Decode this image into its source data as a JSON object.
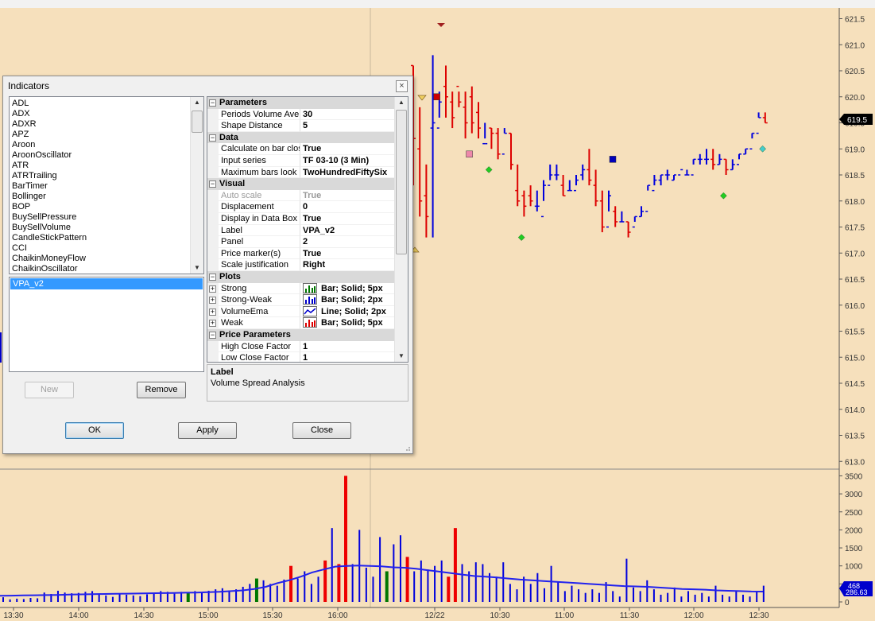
{
  "dialog": {
    "title": "Indicators",
    "indicators": [
      "ADL",
      "ADX",
      "ADXR",
      "APZ",
      "Aroon",
      "AroonOscillator",
      "ATR",
      "ATRTrailing",
      "BarTimer",
      "Bollinger",
      "BOP",
      "BuySellPressure",
      "BuySellVolume",
      "CandleStickPattern",
      "CCI",
      "ChaikinMoneyFlow",
      "ChaikinOscillator"
    ],
    "active_indicator": "VPA_v2",
    "buttons": {
      "new": "New",
      "remove": "Remove",
      "ok": "OK",
      "apply": "Apply",
      "close": "Close"
    },
    "properties": [
      {
        "type": "category",
        "label": "Parameters"
      },
      {
        "name": "Periods Volume Average",
        "value": "30"
      },
      {
        "name": "Shape Distance",
        "value": "5"
      },
      {
        "type": "category",
        "label": "Data"
      },
      {
        "name": "Calculate on bar close",
        "value": "True"
      },
      {
        "name": "Input series",
        "value": "TF 03-10 (3 Min)"
      },
      {
        "name": "Maximum bars look back",
        "value": "TwoHundredFiftySix"
      },
      {
        "type": "category",
        "label": "Visual"
      },
      {
        "name": "Auto scale",
        "value": "True",
        "disabled": true
      },
      {
        "name": "Displacement",
        "value": "0"
      },
      {
        "name": "Display in Data Box",
        "value": "True"
      },
      {
        "name": "Label",
        "value": "VPA_v2"
      },
      {
        "name": "Panel",
        "value": "2"
      },
      {
        "name": "Price marker(s)",
        "value": "True"
      },
      {
        "name": "Scale justification",
        "value": "Right"
      },
      {
        "type": "category",
        "label": "Plots"
      },
      {
        "name": "Strong",
        "value": "Bar; Solid; 5px",
        "icon": "bar-green",
        "expandable": true
      },
      {
        "name": "Strong-Weak",
        "value": "Bar; Solid; 2px",
        "icon": "bar-blue",
        "expandable": true
      },
      {
        "name": "VolumeEma",
        "value": "Line; Solid; 2px",
        "icon": "line-blue",
        "expandable": true
      },
      {
        "name": "Weak",
        "value": "Bar; Solid; 5px",
        "icon": "bar-red",
        "expandable": true
      },
      {
        "type": "category",
        "label": "Price Parameters"
      },
      {
        "name": "High Close Factor",
        "value": "1"
      },
      {
        "name": "Low Close Factor",
        "value": "1"
      }
    ],
    "description": {
      "title": "Label",
      "text": "Volume Spread Analysis"
    }
  },
  "price_axis": {
    "labels": [
      "621.5",
      "621.0",
      "620.5",
      "620.0",
      "619.5",
      "619.0",
      "618.5",
      "618.0",
      "617.5",
      "617.0",
      "616.5",
      "616.0",
      "615.5",
      "615.0",
      "614.5",
      "614.0",
      "613.5",
      "613.0"
    ],
    "current_price": "619.5",
    "current_price_color": "#000000"
  },
  "volume_axis": {
    "labels": [
      "3500",
      "3000",
      "2500",
      "2000",
      "1500",
      "1000",
      "500",
      "0"
    ],
    "current_volume": "468",
    "current_ema": "286.63",
    "current_color": "#0000cc"
  },
  "time_axis": {
    "labels": [
      "13:30",
      "14:00",
      "14:30",
      "15:00",
      "15:30",
      "16:00",
      "12/22",
      "10:30",
      "11:00",
      "11:30",
      "12:00",
      "12:30"
    ]
  },
  "colors": {
    "background": "#f6e0bc",
    "up_bar": "#0000dd",
    "down_bar": "#dd0000",
    "strong_volume": "#007700",
    "weak_volume": "#ee0000",
    "ema": "#2222ee"
  },
  "chart_data": {
    "type": "ohlc",
    "price_bars": [
      [
        620.6,
        620.6,
        618.3,
        619.2
      ],
      [
        619.8,
        619.0,
        617.7,
        618.0
      ],
      [
        618.7,
        618.1,
        617.3,
        617.7
      ],
      [
        620.8,
        619.4,
        617.3,
        619.5
      ],
      [
        620.1,
        619.4,
        619.6,
        619.9
      ],
      [
        620.6,
        620.2,
        619.6,
        620.0
      ],
      [
        620.1,
        619.9,
        619.4,
        619.6
      ],
      [
        620.1,
        620.2,
        619.8,
        619.9
      ],
      [
        620.1,
        619.8,
        619.2,
        619.5
      ],
      [
        620.2,
        620.0,
        619.3,
        619.5
      ],
      [
        619.9,
        619.7,
        619.2,
        619.4
      ],
      [
        619.5,
        619.1,
        619.2,
        619.1
      ],
      [
        619.4,
        619.4,
        619.0,
        619.3
      ],
      [
        619.4,
        619.3,
        618.8,
        618.9
      ],
      [
        619.4,
        618.9,
        619.3,
        619.3
      ],
      [
        619.3,
        619.3,
        618.6,
        618.7
      ],
      [
        618.7,
        618.2,
        617.9,
        618.0
      ],
      [
        618.2,
        618.1,
        617.7,
        617.9
      ],
      [
        618.3,
        618.1,
        617.9,
        618.0
      ],
      [
        618.2,
        617.9,
        617.8,
        617.9
      ],
      [
        618.4,
        617.7,
        618.0,
        618.3
      ],
      [
        618.7,
        618.3,
        618.4,
        618.5
      ],
      [
        618.7,
        618.5,
        618.4,
        618.5
      ],
      [
        618.5,
        618.3,
        618.1,
        618.1
      ],
      [
        618.4,
        618.2,
        618.2,
        618.2
      ],
      [
        618.5,
        618.2,
        618.3,
        618.4
      ],
      [
        618.7,
        618.5,
        618.4,
        618.6
      ],
      [
        619.0,
        618.6,
        618.3,
        618.4
      ],
      [
        618.6,
        618.3,
        617.9,
        618.0
      ],
      [
        618.2,
        618.0,
        617.4,
        617.5
      ],
      [
        618.2,
        617.5,
        617.8,
        618.1
      ],
      [
        617.9,
        617.8,
        617.5,
        617.6
      ],
      [
        617.8,
        617.6,
        617.6,
        617.6
      ],
      [
        617.6,
        617.6,
        617.3,
        617.4
      ],
      [
        617.7,
        617.5,
        617.6,
        617.7
      ],
      [
        617.9,
        617.7,
        617.7,
        617.8
      ],
      [
        618.3,
        617.8,
        618.2,
        618.3
      ],
      [
        618.5,
        618.2,
        618.3,
        618.4
      ],
      [
        618.5,
        618.4,
        618.3,
        618.5
      ],
      [
        618.6,
        618.5,
        618.4,
        618.5
      ],
      [
        618.5,
        618.4,
        618.4,
        618.5
      ],
      [
        618.6,
        618.5,
        618.6,
        618.6
      ],
      [
        618.6,
        618.5,
        618.5,
        618.5
      ],
      [
        618.8,
        618.5,
        618.7,
        618.8
      ],
      [
        618.9,
        618.8,
        618.7,
        618.8
      ],
      [
        619.0,
        618.8,
        618.7,
        618.8
      ],
      [
        619.0,
        618.8,
        618.6,
        618.7
      ],
      [
        618.9,
        618.7,
        618.7,
        618.8
      ],
      [
        618.8,
        618.8,
        618.5,
        618.6
      ],
      [
        618.8,
        618.6,
        618.6,
        618.7
      ],
      [
        618.9,
        618.7,
        618.8,
        618.9
      ],
      [
        619.0,
        618.9,
        618.9,
        619.0
      ],
      [
        619.3,
        619.0,
        619.2,
        619.3
      ],
      [
        619.7,
        619.3,
        619.6,
        619.6
      ],
      [
        619.7,
        619.6,
        619.5,
        619.5
      ]
    ],
    "markers": [
      {
        "shape": "square",
        "color": "#cc0000",
        "x": 3,
        "price": 620.0
      },
      {
        "shape": "square",
        "color": "#ee88aa",
        "x": 8,
        "price": 618.9
      },
      {
        "shape": "diamond",
        "color": "#22cc22",
        "x": 11,
        "price": 618.6
      },
      {
        "shape": "diamond",
        "color": "#22cc22",
        "x": 16,
        "price": 617.3
      },
      {
        "shape": "square",
        "color": "#0000bb",
        "x": 30,
        "price": 618.8
      },
      {
        "shape": "diamond",
        "color": "#22cc22",
        "x": 47,
        "price": 618.1
      },
      {
        "shape": "diamond",
        "color": "#44cccc",
        "x": 53,
        "price": 619.0
      }
    ],
    "volume": [
      [
        130,
        "b"
      ],
      [
        70,
        "b"
      ],
      [
        90,
        "b"
      ],
      [
        80,
        "b"
      ],
      [
        110,
        "b"
      ],
      [
        100,
        "b"
      ],
      [
        260,
        "b"
      ],
      [
        220,
        "b"
      ],
      [
        310,
        "b"
      ],
      [
        260,
        "b"
      ],
      [
        240,
        "b"
      ],
      [
        250,
        "b"
      ],
      [
        280,
        "b"
      ],
      [
        300,
        "b"
      ],
      [
        200,
        "b"
      ],
      [
        180,
        "b"
      ],
      [
        140,
        "b"
      ],
      [
        220,
        "b"
      ],
      [
        200,
        "b"
      ],
      [
        180,
        "b"
      ],
      [
        160,
        "b"
      ],
      [
        210,
        "b"
      ],
      [
        240,
        "b"
      ],
      [
        300,
        "b"
      ],
      [
        280,
        "b"
      ],
      [
        230,
        "b"
      ],
      [
        280,
        "b"
      ],
      [
        250,
        "g"
      ],
      [
        300,
        "b"
      ],
      [
        260,
        "b"
      ],
      [
        310,
        "b"
      ],
      [
        350,
        "b"
      ],
      [
        380,
        "b"
      ],
      [
        320,
        "b"
      ],
      [
        350,
        "b"
      ],
      [
        420,
        "b"
      ],
      [
        500,
        "b"
      ],
      [
        650,
        "g"
      ],
      [
        600,
        "b"
      ],
      [
        500,
        "b"
      ],
      [
        450,
        "b"
      ],
      [
        620,
        "b"
      ],
      [
        1000,
        "r"
      ],
      [
        650,
        "b"
      ],
      [
        850,
        "b"
      ],
      [
        500,
        "b"
      ],
      [
        700,
        "b"
      ],
      [
        1150,
        "r"
      ],
      [
        2050,
        "b"
      ],
      [
        1050,
        "r"
      ],
      [
        3500,
        "r"
      ],
      [
        1050,
        "b"
      ],
      [
        2000,
        "b"
      ],
      [
        950,
        "b"
      ],
      [
        700,
        "b"
      ],
      [
        1800,
        "b"
      ],
      [
        850,
        "g"
      ],
      [
        1600,
        "b"
      ],
      [
        1850,
        "b"
      ],
      [
        1250,
        "r"
      ],
      [
        850,
        "b"
      ],
      [
        1150,
        "b"
      ],
      [
        900,
        "b"
      ],
      [
        1000,
        "b"
      ],
      [
        1150,
        "b"
      ],
      [
        700,
        "r"
      ],
      [
        2050,
        "r"
      ],
      [
        1050,
        "b"
      ],
      [
        850,
        "b"
      ],
      [
        1100,
        "b"
      ],
      [
        1050,
        "b"
      ],
      [
        800,
        "b"
      ],
      [
        700,
        "b"
      ],
      [
        1100,
        "b"
      ],
      [
        500,
        "b"
      ],
      [
        350,
        "b"
      ],
      [
        700,
        "b"
      ],
      [
        500,
        "b"
      ],
      [
        800,
        "b"
      ],
      [
        380,
        "b"
      ],
      [
        1000,
        "b"
      ],
      [
        550,
        "b"
      ],
      [
        300,
        "b"
      ],
      [
        450,
        "b"
      ],
      [
        350,
        "b"
      ],
      [
        250,
        "b"
      ],
      [
        350,
        "b"
      ],
      [
        250,
        "b"
      ],
      [
        550,
        "b"
      ],
      [
        300,
        "b"
      ],
      [
        150,
        "b"
      ],
      [
        1200,
        "b"
      ],
      [
        400,
        "b"
      ],
      [
        300,
        "b"
      ],
      [
        600,
        "b"
      ],
      [
        350,
        "b"
      ],
      [
        200,
        "b"
      ],
      [
        250,
        "b"
      ],
      [
        400,
        "b"
      ],
      [
        150,
        "b"
      ],
      [
        300,
        "b"
      ],
      [
        200,
        "b"
      ],
      [
        250,
        "b"
      ],
      [
        150,
        "b"
      ],
      [
        450,
        "b"
      ],
      [
        200,
        "b"
      ],
      [
        150,
        "b"
      ],
      [
        300,
        "b"
      ],
      [
        200,
        "b"
      ],
      [
        150,
        "b"
      ],
      [
        300,
        "b"
      ],
      [
        450,
        "b"
      ]
    ],
    "ema": [
      170,
      175,
      180,
      185,
      190,
      195,
      205,
      210,
      215,
      220,
      225,
      230,
      235,
      240,
      245,
      250,
      255,
      260,
      270,
      280,
      300,
      320,
      360,
      420,
      520,
      600,
      700,
      820,
      900,
      980,
      1000,
      1010,
      1000,
      990,
      960,
      950,
      920,
      880,
      840,
      800,
      760,
      720,
      700,
      680,
      650,
      620,
      600,
      580,
      560,
      540,
      520,
      500,
      480,
      460,
      440,
      430,
      420,
      400,
      380,
      360,
      350,
      340,
      320,
      310,
      300,
      290,
      286.63
    ]
  }
}
